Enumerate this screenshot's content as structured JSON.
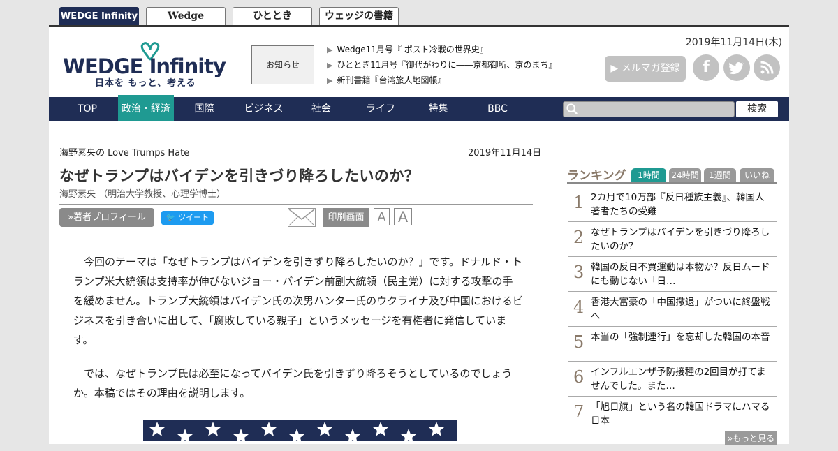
{
  "site_tabs": [
    {
      "label": "WEDGE Infinity"
    },
    {
      "label": "Wedge"
    },
    {
      "label": "ひととき"
    },
    {
      "label": "ウェッジの書籍"
    }
  ],
  "header": {
    "logo_main": "WEDGE Infinity",
    "logo_sub": "日本を もっと、考える",
    "notice": "お知らせ",
    "news": [
      "Wedge11月号『 ポスト冷戦の世界史』",
      "ひととき11月号『御代がわりに――京都御所、京のまち』",
      "新刊書籍『台湾旅人地図帳』"
    ],
    "date": "2019年11月14日(木)",
    "mailmag": "メルマガ登録",
    "social_icons": [
      "facebook-icon",
      "twitter-icon",
      "rss-icon"
    ]
  },
  "nav": {
    "items": [
      "TOP",
      "政治・経済",
      "国際",
      "ビジネス",
      "社会",
      "ライフ",
      "特集",
      "BBC"
    ],
    "active": "政治・経済",
    "search_placeholder": "",
    "search_label": "検索"
  },
  "article": {
    "series": "海野素央の Love Trumps Hate",
    "date": "2019年11月14日",
    "title": "なぜトランプはバイデンを引きづり降ろしたいのか？",
    "author": "海野素央 （明治大学教授、心理学博士）",
    "profile_btn": "»著者プロフィール",
    "tweet_btn": "ツイート",
    "print_btn": "印刷画面",
    "font_small": "A",
    "font_large": "A",
    "paragraphs": [
      "今回のテーマは「なぜトランプはバイデンを引きずり降ろしたいのか？」です。ドナルド・トランプ米大統領は支持率が伸びないジョー・バイデン前副大統領（民主党）に対する攻撃の手を緩めません。トランプ大統領はバイデン氏の次男ハンター氏のウクライナ及び中国におけるビジネスを引き合いに出して、「腐敗している親子」というメッセージを有権者に発信しています。",
      "では、なぜトランプ氏は必至になってバイデン氏を引きずり降ろそうとしているのでしょうか。本稿ではその理由を説明します。"
    ]
  },
  "ranking": {
    "title": "ランキング",
    "tabs": [
      "1時間",
      "24時間",
      "1週間",
      "いいね"
    ],
    "active_tab": "1時間",
    "items": [
      {
        "num": "1",
        "text": "2カ月で10万部『反日種族主義』、韓国人著者たちの受難"
      },
      {
        "num": "2",
        "text": "なぜトランプはバイデンを引きづり降ろしたいのか？"
      },
      {
        "num": "3",
        "text": "韓国の反日不買運動は本物か？反日ムードにも動じない「日…"
      },
      {
        "num": "4",
        "text": "香港大富豪の「中国撤退」がついに終盤戦へ"
      },
      {
        "num": "5",
        "text": "本当の「強制連行」を忘却した韓国の本音"
      },
      {
        "num": "6",
        "text": "インフルエンザ予防接種の2回目が打てませんでした。また…"
      },
      {
        "num": "7",
        "text": "「旭日旗」という名の韓国ドラマにハマる日本"
      }
    ],
    "more": "»もっと見る"
  },
  "colors": {
    "navy": "#1f2d55",
    "teal": "#1f9a92",
    "gray_button": "#8a8a8a",
    "ranking_brown": "#8a7a6a"
  }
}
